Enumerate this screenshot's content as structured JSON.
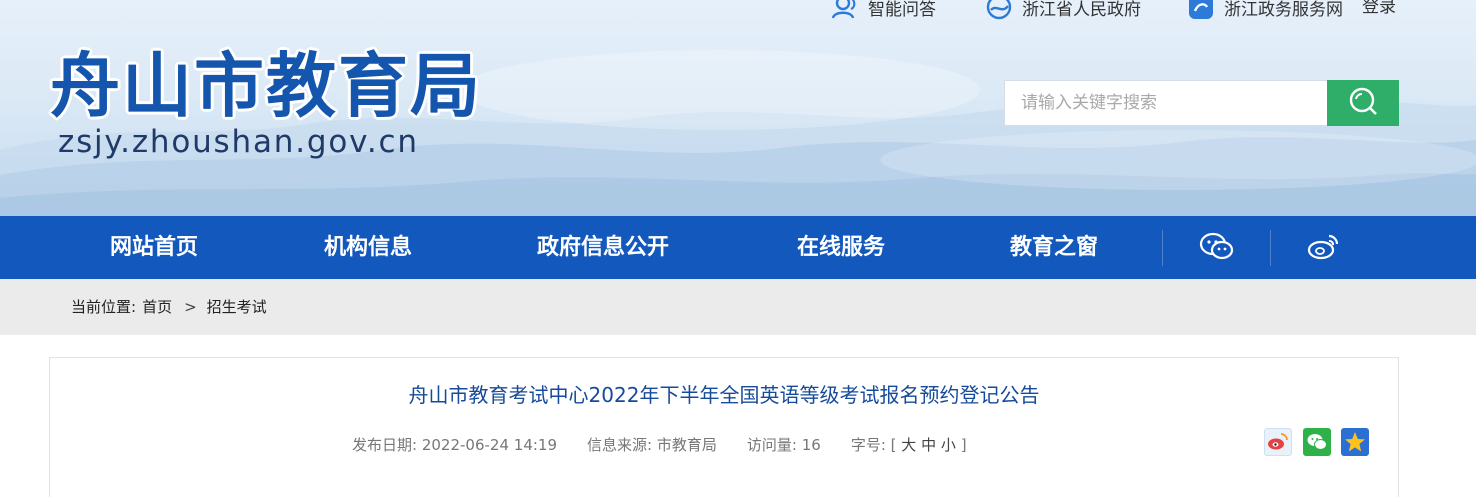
{
  "top_links": [
    {
      "label": "智能问答",
      "icon": "people-icon"
    },
    {
      "label": "浙江省人民政府",
      "icon": "zj-gov-icon"
    },
    {
      "label": "浙江政务服务网",
      "icon": "zj-service-icon"
    }
  ],
  "login_label": "登录",
  "logo": {
    "title_cn": "舟山市教育局",
    "domain": "zsjy.zhoushan.gov.cn"
  },
  "search": {
    "placeholder": "请输入关键字搜索"
  },
  "nav": {
    "items": [
      "网站首页",
      "机构信息",
      "政府信息公开",
      "在线服务",
      "教育之窗"
    ],
    "icons": [
      "wechat-icon",
      "weibo-icon"
    ]
  },
  "breadcrumb": {
    "prefix": "当前位置:",
    "home": "首页",
    "separator": ">",
    "current": "招生考试"
  },
  "article": {
    "title": "舟山市教育考试中心2022年下半年全国英语等级考试报名预约登记公告",
    "meta": {
      "date_label": "发布日期:",
      "date": "2022-06-24 14:19",
      "source_label": "信息来源:",
      "source": "市教育局",
      "views_label": "访问量:",
      "views": "16",
      "font_label": "字号:",
      "bracket_open": "[",
      "font_large": "大",
      "font_medium": "中",
      "font_small": "小",
      "bracket_close": "]"
    },
    "share_icons": [
      "weibo-share-icon",
      "wechat-share-icon",
      "qzone-share-icon"
    ]
  },
  "colors": {
    "nav_bg": "#1359bd",
    "search_btn": "#2fae69",
    "title": "#164a9a",
    "logo": "#1455ad"
  }
}
